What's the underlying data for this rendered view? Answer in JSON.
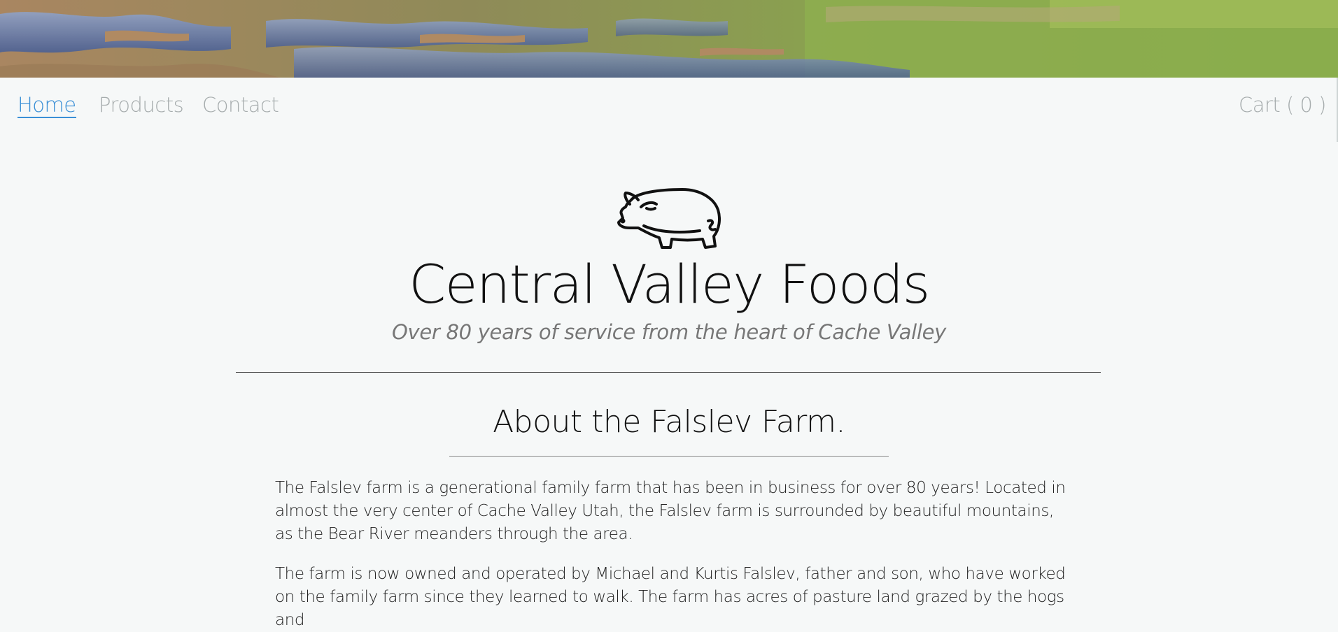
{
  "banner": {
    "alt": "Cache Valley wetlands landscape"
  },
  "nav": {
    "items": [
      {
        "label": "Home",
        "active": true
      },
      {
        "label": "Products",
        "active": false
      },
      {
        "label": "Contact",
        "active": false
      }
    ],
    "cart_label": "Cart ( 0 )"
  },
  "hero": {
    "logo_icon": "pig-icon",
    "title": "Central Valley Foods",
    "subtitle": "Over 80 years of service from the heart of Cache Valley"
  },
  "about": {
    "heading": "About the Falslev Farm.",
    "paragraphs": [
      "The Falslev farm is a generational family farm that has been in business for over 80 years! Located in almost the very center of Cache Valley Utah, the Falslev farm is surrounded by beautiful mountains, as the Bear River meanders through the area.",
      "The farm is now owned and operated by Michael and Kurtis Falslev, father and son, who have worked on the family farm since they learned to walk. The farm has acres of pasture land grazed by the hogs and"
    ]
  }
}
